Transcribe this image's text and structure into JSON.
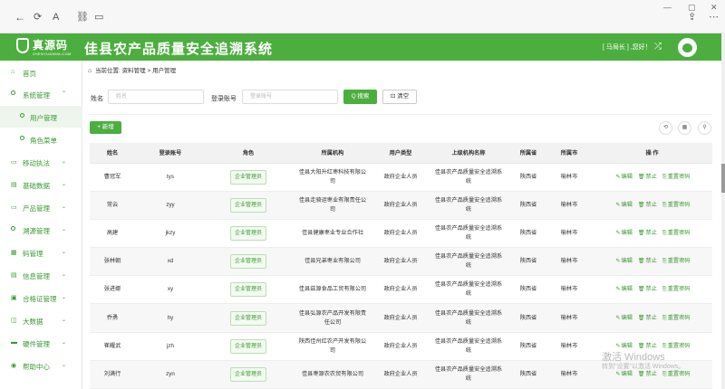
{
  "browser": {
    "back_icon": "←",
    "refresh_icon": "⟳",
    "font_icon": "A",
    "link_icon": "⛓",
    "window_icon": "▭",
    "minimize": "—",
    "maximize": "▢",
    "close": "✕",
    "share_icon": "⇪",
    "menu_icon": "⋯"
  },
  "header": {
    "logo_main": "真源码",
    "logo_sub": "ZHENYUANMA.COM",
    "title": "佳县农产品质量安全追溯系统",
    "user": "[ 马局长 ] ,您好！",
    "shuffle_icon": "⤮"
  },
  "sidebar": {
    "items": [
      {
        "label": "首页",
        "icon": "⌂",
        "arrow": ""
      },
      {
        "label": "系统管理",
        "icon": "●",
        "arrow": "⌃"
      },
      {
        "label": "用户管理",
        "icon": "●",
        "arrow": ""
      },
      {
        "label": "角色菜单",
        "icon": "●",
        "arrow": ""
      },
      {
        "label": "移动执法",
        "icon": "▭",
        "arrow": "⌄"
      },
      {
        "label": "基础数据",
        "icon": "▤",
        "arrow": "⌄"
      },
      {
        "label": "产品管理",
        "icon": "▭",
        "arrow": "⌄"
      },
      {
        "label": "溯源管理",
        "icon": "●",
        "arrow": "⌄"
      },
      {
        "label": "码管理",
        "icon": "▦",
        "arrow": "⌄"
      },
      {
        "label": "信息管理",
        "icon": "▤",
        "arrow": "⌄"
      },
      {
        "label": "合格证管理",
        "icon": "▣",
        "arrow": "⌄"
      },
      {
        "label": "大数据",
        "icon": "◫",
        "arrow": "⌄"
      },
      {
        "label": "硬件管理",
        "icon": "▬",
        "arrow": "⌄"
      },
      {
        "label": "帮助中心",
        "icon": "◉",
        "arrow": "⌄"
      }
    ]
  },
  "breadcrumb": {
    "home_icon": "⌂",
    "text": "当前位置: 资料管理 > 用户管理"
  },
  "search": {
    "name_label": "姓名",
    "name_placeholder": "姓名",
    "account_label": "登录账号",
    "account_placeholder": "登录账号",
    "search_btn": "Q 搜索",
    "clear_btn": "⊡ 清空"
  },
  "toolbar": {
    "add_btn": "+ 新增",
    "refresh_icon": "⟲",
    "grid_icon": "▦",
    "search_icon": "⚲"
  },
  "table": {
    "headers": [
      "姓名",
      "登录账号",
      "角色",
      "所属机构",
      "用户类型",
      "上级机构名称",
      "所属省",
      "所属市",
      "操 作"
    ],
    "op_edit": "编辑",
    "op_disable": "禁止",
    "op_reset": "重置密码",
    "op_edit_icon": "✎",
    "op_disable_icon": "🗑",
    "op_reset_icon": "⎘",
    "rows": [
      {
        "name": "曹冠军",
        "account": "tys",
        "role": "企业管理员",
        "org": "佳县大阳升红枣科技有限公司",
        "type": "政府企业人员",
        "parent": "佳县农产品质量安全追溯系统",
        "province": "陕西省",
        "city": "榆林市"
      },
      {
        "name": "常云",
        "account": "zyy",
        "role": "企业管理员",
        "org": "佳县走骑运枣业有限责任公司",
        "type": "政府企业人员",
        "parent": "佳县农产品质量安全追溯系统",
        "province": "陕西省",
        "city": "榆林市"
      },
      {
        "name": "高建",
        "account": "jkzy",
        "role": "企业管理员",
        "org": "佳县健康枣业专业合作社",
        "type": "政府企业人员",
        "parent": "佳县农产品质量安全追溯系统",
        "province": "陕西省",
        "city": "榆林市"
      },
      {
        "name": "张林朝",
        "account": "xd",
        "role": "企业管理员",
        "org": "佳县兄弟枣业有限公司",
        "type": "政府企业人员",
        "parent": "佳县农产品质量安全追溯系统",
        "province": "陕西省",
        "city": "榆林市"
      },
      {
        "name": "张进娜",
        "account": "xy",
        "role": "企业管理员",
        "org": "佳县兹源食品工贸有限公司",
        "type": "政府企业人员",
        "parent": "佳县农产品质量安全追溯系统",
        "province": "陕西省",
        "city": "榆林市"
      },
      {
        "name": "乔勇",
        "account": "hy",
        "role": "企业管理员",
        "org": "佳县弘源农产品开发有限责任公司",
        "type": "政府企业人员",
        "parent": "佳县农产品质量安全追溯系统",
        "province": "陕西省",
        "city": "榆林市"
      },
      {
        "name": "崔耀武",
        "account": "jzh",
        "role": "企业管理员",
        "org": "陕西佳州红农产开发有限公司",
        "type": "政府企业人员",
        "parent": "佳县农产品质量安全追溯系统",
        "province": "陕西省",
        "city": "榆林市"
      },
      {
        "name": "刘满行",
        "account": "zyn",
        "role": "企业管理员",
        "org": "佳县枣源农农贸有限公司",
        "type": "政府企业人员",
        "parent": "佳县农产品质量安全追溯系统",
        "province": "陕西省",
        "city": "榆林市"
      }
    ]
  },
  "watermark": {
    "title": "激活 Windows",
    "sub": "转到\"设置\"以激活 Windows。"
  }
}
